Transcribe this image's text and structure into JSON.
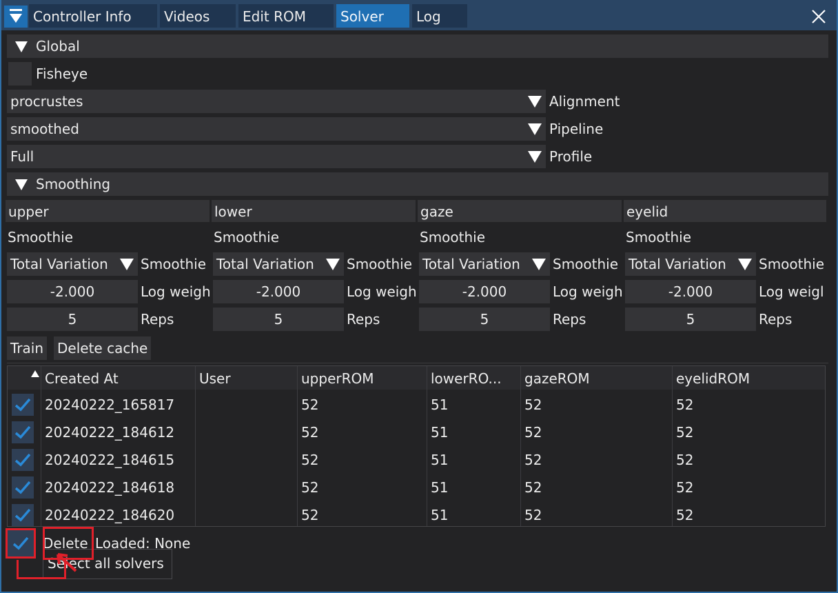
{
  "tabs": [
    "Controller Info",
    "Videos",
    "Edit ROM",
    "Solver",
    "Log"
  ],
  "active_tab": "Solver",
  "global": {
    "header": "Global",
    "fisheye_label": "Fisheye",
    "alignment": {
      "value": "procrustes",
      "label": "Alignment"
    },
    "pipeline": {
      "value": "smoothed",
      "label": "Pipeline"
    },
    "profile": {
      "value": "Full",
      "label": "Profile"
    }
  },
  "smoothing": {
    "header": "Smoothing",
    "columns": [
      {
        "name": "upper",
        "title": "Smoothie",
        "method": "Total Variation",
        "method_label": "Smoothie",
        "log_weight": "-2.000",
        "log_weight_label": "Log weigh",
        "reps": "5",
        "reps_label": "Reps"
      },
      {
        "name": "lower",
        "title": "Smoothie",
        "method": "Total Variation",
        "method_label": "Smoothie",
        "log_weight": "-2.000",
        "log_weight_label": "Log weigh",
        "reps": "5",
        "reps_label": "Reps"
      },
      {
        "name": "gaze",
        "title": "Smoothie",
        "method": "Total Variation",
        "method_label": "Smoothie",
        "log_weight": "-2.000",
        "log_weight_label": "Log weigh",
        "reps": "5",
        "reps_label": "Reps"
      },
      {
        "name": "eyelid",
        "title": "Smoothie",
        "method": "Total Variation",
        "method_label": "Smoothie",
        "log_weight": "-2.000",
        "log_weight_label": "Log weigl",
        "reps": "5",
        "reps_label": "Reps"
      }
    ]
  },
  "actions": {
    "train": "Train",
    "delete_cache": "Delete cache"
  },
  "table": {
    "headers": [
      "Created At",
      "User",
      "upperROM",
      "lowerRO...",
      "gazeROM",
      "eyelidROM"
    ],
    "rows": [
      [
        "20240222_165817",
        "",
        "52",
        "51",
        "52",
        "52"
      ],
      [
        "20240222_184612",
        "",
        "52",
        "51",
        "52",
        "52"
      ],
      [
        "20240222_184615",
        "",
        "52",
        "51",
        "52",
        "52"
      ],
      [
        "20240222_184618",
        "",
        "52",
        "51",
        "52",
        "52"
      ],
      [
        "20240222_184620",
        "",
        "52",
        "51",
        "52",
        "52"
      ]
    ]
  },
  "footer": {
    "delete_label": "Delete",
    "loaded_text": "Loaded:  None",
    "tooltip": "Select all solvers"
  },
  "colors": {
    "accent": "#1f6fb3",
    "highlight": "#e0202a"
  },
  "icons": {
    "menu": "menu-icon",
    "close": "close-icon",
    "check": "check-icon"
  }
}
